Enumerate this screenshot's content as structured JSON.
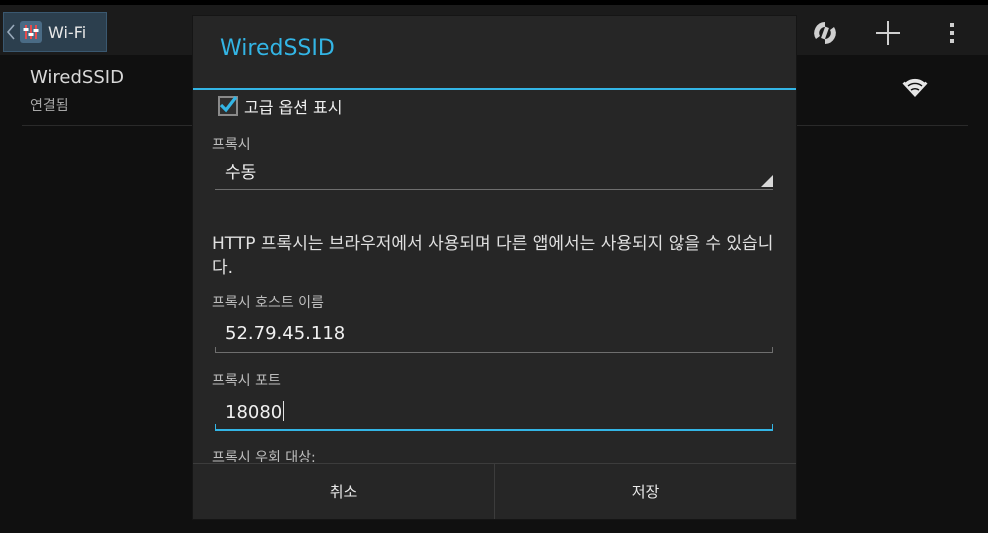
{
  "actionbar": {
    "title": "Wi-Fi",
    "icons": [
      "back-chevron-icon",
      "wifi-settings-app-icon",
      "wps-push-icon",
      "add-icon",
      "overflow-menu-icon"
    ]
  },
  "network_list": [
    {
      "ssid": "WiredSSID",
      "status": "연결됨",
      "icon": "wifi-signal-full-icon"
    }
  ],
  "dialog": {
    "title": "WiredSSID",
    "advanced_options": {
      "label": "고급 옵션 표시",
      "checked": true
    },
    "proxy": {
      "label": "프록시",
      "value": "수동"
    },
    "info": "HTTP 프록시는 브라우저에서 사용되며 다른 앱에서는 사용되지 않을 수 있습니다.",
    "proxy_host": {
      "label": "프록시 호스트 이름",
      "value": "52.79.45.118"
    },
    "proxy_port": {
      "label": "프록시 포트",
      "value": "18080"
    },
    "bypass": {
      "label": "프록시 우회 대상:"
    },
    "buttons": {
      "cancel": "취소",
      "save": "저장"
    }
  },
  "colors": {
    "accent": "#33b5e5",
    "dialog_bg": "#262626",
    "screen_bg": "#101010"
  }
}
